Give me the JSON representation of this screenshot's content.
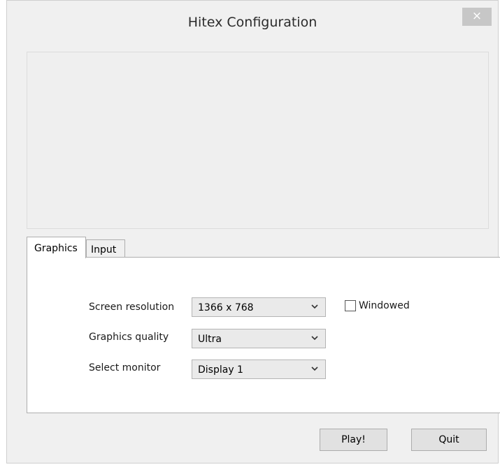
{
  "window": {
    "title": "Hitex Configuration",
    "close_label": "×"
  },
  "tabs": [
    {
      "label": "Graphics",
      "selected": true
    },
    {
      "label": "Input",
      "selected": false
    }
  ],
  "graphics": {
    "screen_resolution": {
      "label": "Screen resolution",
      "value": "1366 x 768"
    },
    "graphics_quality": {
      "label": "Graphics quality",
      "value": "Ultra"
    },
    "select_monitor": {
      "label": "Select monitor",
      "value": "Display 1"
    },
    "windowed": {
      "label": "Windowed",
      "checked": false
    }
  },
  "buttons": {
    "play": "Play!",
    "quit": "Quit"
  },
  "icons": {
    "close": "close-icon",
    "dropdown": "chevron-down-icon"
  },
  "colors": {
    "window_bg": "#f0f0f0",
    "panel_bg": "#ffffff",
    "close_bg": "#c7c7c7"
  }
}
